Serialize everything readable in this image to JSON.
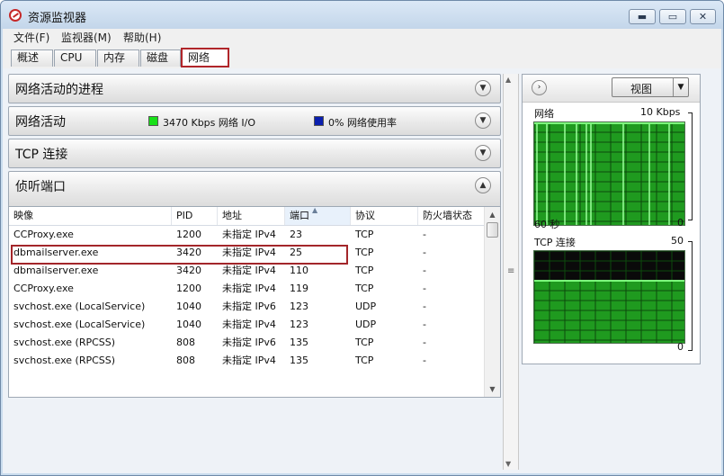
{
  "window": {
    "title": "资源监视器",
    "btn_min": "▬",
    "btn_max": "▭",
    "btn_close": "✕"
  },
  "menu": [
    "文件(F)",
    "监视器(M)",
    "帮助(H)"
  ],
  "tabs": [
    "概述",
    "CPU",
    "内存",
    "磁盘",
    "网络"
  ],
  "active_tab": "网络",
  "sections": {
    "processes": {
      "title": "网络活动的进程"
    },
    "activity": {
      "title": "网络活动",
      "io_text": "3470 Kbps 网络 I/O",
      "usage_text": "0% 网络使用率",
      "io_color": "#19e019",
      "usage_color": "#0a1fae"
    },
    "tcp": {
      "title": "TCP 连接"
    },
    "listening": {
      "title": "侦听端口"
    }
  },
  "table": {
    "columns": [
      "映像",
      "PID",
      "地址",
      "端口",
      "协议",
      "防火墙状态"
    ],
    "sorted_column": "端口",
    "rows": [
      [
        "CCProxy.exe",
        "1200",
        "未指定 IPv4",
        "23",
        "TCP",
        "-"
      ],
      [
        "dbmailserver.exe",
        "3420",
        "未指定 IPv4",
        "25",
        "TCP",
        "-"
      ],
      [
        "dbmailserver.exe",
        "3420",
        "未指定 IPv4",
        "110",
        "TCP",
        "-"
      ],
      [
        "CCProxy.exe",
        "1200",
        "未指定 IPv4",
        "119",
        "TCP",
        "-"
      ],
      [
        "svchost.exe (LocalService)",
        "1040",
        "未指定 IPv6",
        "123",
        "UDP",
        "-"
      ],
      [
        "svchost.exe (LocalService)",
        "1040",
        "未指定 IPv4",
        "123",
        "UDP",
        "-"
      ],
      [
        "svchost.exe (RPCSS)",
        "808",
        "未指定 IPv6",
        "135",
        "TCP",
        "-"
      ],
      [
        "svchost.exe (RPCSS)",
        "808",
        "未指定 IPv4",
        "135",
        "TCP",
        "-"
      ]
    ],
    "highlighted_row": 1
  },
  "right_panel": {
    "view_label": "视图",
    "network_graph": {
      "title": "网络",
      "max_label": "10 Kbps",
      "time_label": "60 秒",
      "min_label": "0"
    },
    "tcp_graph": {
      "title": "TCP 连接",
      "max_label": "50",
      "min_label": "0"
    }
  },
  "icons": {
    "app": "resource-monitor-icon",
    "expand": "chevron-down-icon",
    "collapse": "chevron-up-icon",
    "panel_toggle": "chevron-right-icon",
    "dropdown": "dropdown-arrow-icon"
  }
}
